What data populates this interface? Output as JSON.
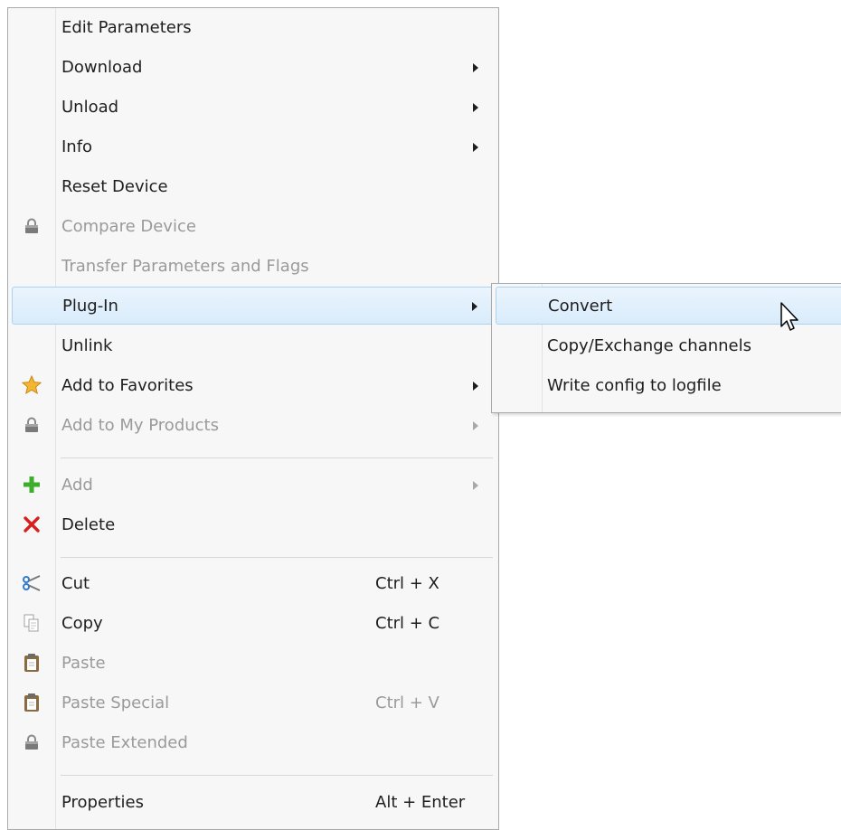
{
  "context_menu": {
    "items": [
      {
        "label": "Edit Parameters",
        "shortcut": "",
        "submenu": false,
        "disabled": false,
        "icon": ""
      },
      {
        "label": "Download",
        "shortcut": "",
        "submenu": true,
        "disabled": false,
        "icon": ""
      },
      {
        "label": "Unload",
        "shortcut": "",
        "submenu": true,
        "disabled": false,
        "icon": ""
      },
      {
        "label": "Info",
        "shortcut": "",
        "submenu": true,
        "disabled": false,
        "icon": ""
      },
      {
        "label": "Reset Device",
        "shortcut": "",
        "submenu": false,
        "disabled": false,
        "icon": ""
      },
      {
        "label": "Compare Device",
        "shortcut": "",
        "submenu": false,
        "disabled": true,
        "icon": "lock-icon"
      },
      {
        "label": "Transfer Parameters and Flags",
        "shortcut": "",
        "submenu": false,
        "disabled": true,
        "icon": ""
      },
      {
        "label": "Plug-In",
        "shortcut": "",
        "submenu": true,
        "disabled": false,
        "icon": "",
        "highlighted": true
      },
      {
        "label": "Unlink",
        "shortcut": "",
        "submenu": false,
        "disabled": false,
        "icon": ""
      },
      {
        "label": "Add to Favorites",
        "shortcut": "",
        "submenu": true,
        "disabled": false,
        "icon": "star-icon"
      },
      {
        "label": "Add to My Products",
        "shortcut": "",
        "submenu": true,
        "disabled": true,
        "icon": "lock-icon"
      },
      {
        "label": "Add",
        "shortcut": "",
        "submenu": true,
        "disabled": true,
        "icon": "plus-icon"
      },
      {
        "label": "Delete",
        "shortcut": "",
        "submenu": false,
        "disabled": false,
        "icon": "delete-x-icon"
      },
      {
        "label": "Cut",
        "shortcut": "Ctrl + X",
        "submenu": false,
        "disabled": false,
        "icon": "scissors-icon"
      },
      {
        "label": "Copy",
        "shortcut": "Ctrl + C",
        "submenu": false,
        "disabled": false,
        "icon": "copy-icon"
      },
      {
        "label": "Paste",
        "shortcut": "",
        "submenu": false,
        "disabled": true,
        "icon": "clipboard-icon"
      },
      {
        "label": "Paste Special",
        "shortcut": "Ctrl + V",
        "submenu": false,
        "disabled": true,
        "icon": "clipboard-icon"
      },
      {
        "label": "Paste Extended",
        "shortcut": "",
        "submenu": false,
        "disabled": true,
        "icon": "lock-icon"
      },
      {
        "label": "Properties",
        "shortcut": "Alt + Enter",
        "submenu": false,
        "disabled": false,
        "icon": ""
      }
    ]
  },
  "plugin_submenu": {
    "items": [
      {
        "label": "Convert",
        "highlighted": true
      },
      {
        "label": "Copy/Exchange channels"
      },
      {
        "label": "Write config to logfile"
      }
    ]
  },
  "colors": {
    "menu_background": "#f7f7f7",
    "highlight_border": "#a9d3f5",
    "disabled_text": "#9a9a9a",
    "star": "#f2b632",
    "plus": "#3dae2b",
    "delete_x": "#d81e1e"
  }
}
